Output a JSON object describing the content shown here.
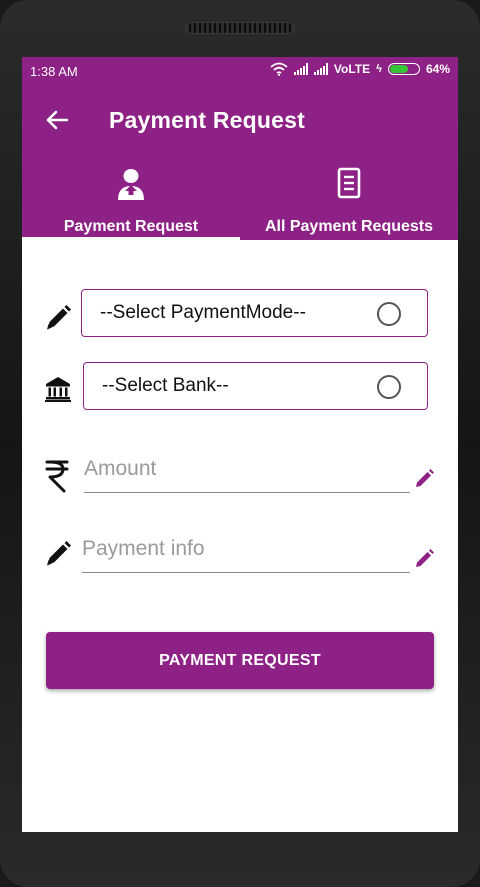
{
  "status_bar": {
    "time": "1:38 AM",
    "network": "VoLTE",
    "battery": "64%",
    "battery_level": 0.64
  },
  "toolbar": {
    "back_icon": "arrow-left-icon",
    "title": "Payment Request"
  },
  "tabs": [
    {
      "label": "Payment Request",
      "icon": "user-upload-icon",
      "active": true
    },
    {
      "label": "All Payment Requests",
      "icon": "document-list-icon",
      "active": false
    }
  ],
  "form": {
    "payment_mode": {
      "icon": "pencil-icon",
      "label": "--Select PaymentMode--"
    },
    "bank": {
      "icon": "bank-icon",
      "label": "--Select Bank--"
    },
    "amount": {
      "icon": "rupee-icon",
      "placeholder": "Amount",
      "value": ""
    },
    "payment_info": {
      "icon": "pencil-icon",
      "placeholder": "Payment info",
      "value": ""
    },
    "submit_label": "PAYMENT REQUEST"
  },
  "colors": {
    "primary": "#8e2185",
    "battery_fill": "#35c435"
  }
}
